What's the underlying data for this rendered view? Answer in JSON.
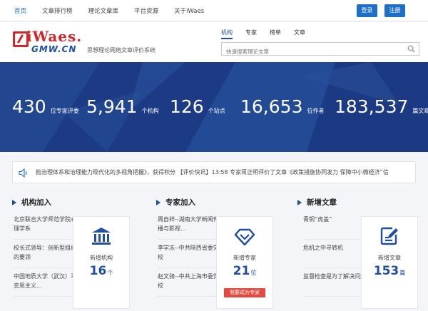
{
  "nav": {
    "items": [
      "首页",
      "文章排行榜",
      "理论文章库",
      "平台资源",
      "关于iWaes"
    ],
    "login": "登录",
    "register": "注册"
  },
  "logo": {
    "name": "iWaes.",
    "domain": "GMW.CN",
    "slogan": "思想理论网络文章评价系统"
  },
  "tabs": [
    "机构",
    "专家",
    "榜单",
    "文章"
  ],
  "search": {
    "placeholder": "快速搜索理论文章"
  },
  "stats": [
    {
      "value": "430",
      "unit": "位专家评委"
    },
    {
      "value": "5,941",
      "unit": "个机构"
    },
    {
      "value": "126",
      "unit": "个站点"
    },
    {
      "value": "16,653",
      "unit": "位作者"
    },
    {
      "value": "183,537",
      "unit": "篇文章"
    }
  ],
  "ticker": {
    "text": "韵治理体系和治理能力现代化的多视角把握》，获得积分  【评价快讯】13:58 专家蒋正明评价了文章《政策措施协同发力 保障中小微经济“信"
  },
  "sections": {
    "institutions": {
      "title": "机构加入",
      "items": [
        "北京联合大学师范学院心理学系",
        "校长式领导：创新型组织的要领",
        "中国地质大学（武汉）马克思主义..."
      ],
      "card_label": "新增机构",
      "card_count": "16",
      "card_unit": "个"
    },
    "experts": {
      "title": "专家加入",
      "items": [
        "周自祥--湖南大学新闻传播与影视...",
        "李学冻--中共陕西省委党校",
        "赵文骑--中共上海市委党校"
      ],
      "card_label": "新增专家",
      "card_count": "21",
      "card_unit": "位",
      "card_button": "我要成为专家"
    },
    "articles": {
      "title": "新增文章",
      "items": [
        "青铜“虎盖”",
        "危机之中寻转机",
        "监督检查是为了解决问题"
      ],
      "card_label": "新增文章",
      "card_count": "153",
      "card_unit": "篇"
    }
  },
  "colors": {
    "brand_blue": "#1e6fc8",
    "banner": "#1f3f8d",
    "logo_red": "#d2262a",
    "accent_red": "#e34b3f"
  }
}
